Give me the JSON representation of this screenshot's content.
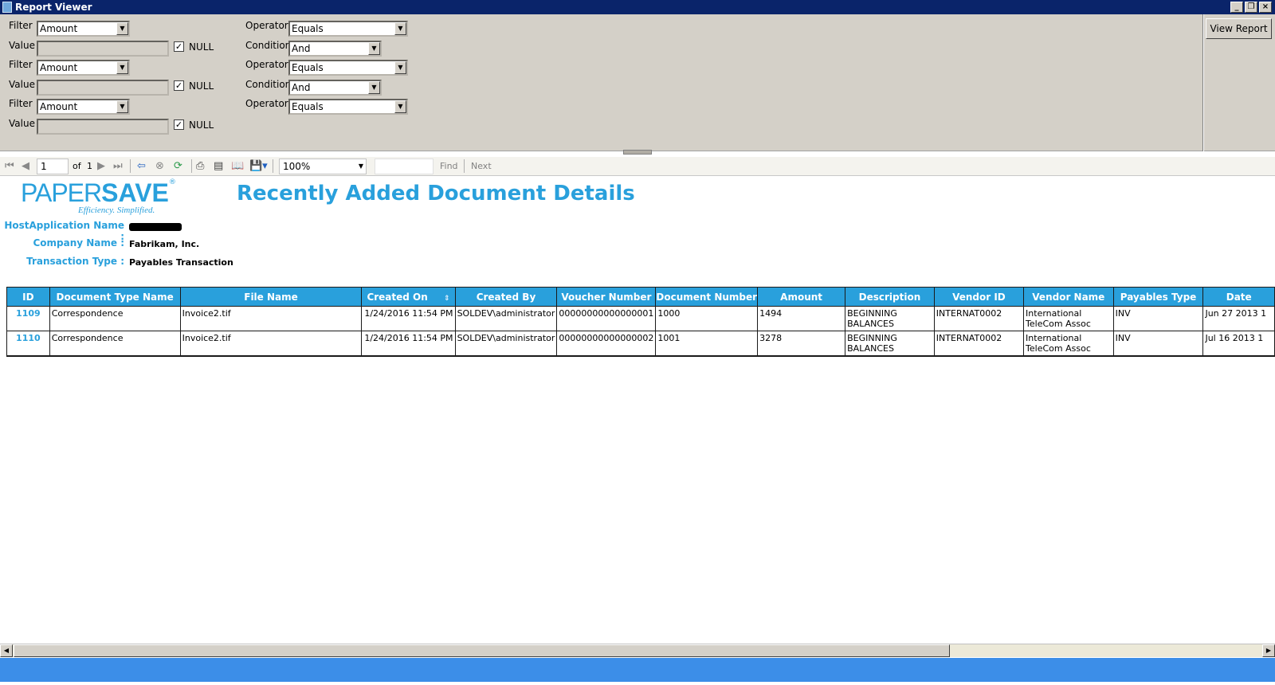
{
  "window": {
    "title": "Report Viewer"
  },
  "params": {
    "rows": [
      {
        "filter_label": "Filter",
        "filter_value": "Amount",
        "operator_label": "Operator",
        "operator_value": "Equals",
        "value_label": "Value",
        "null_label": "NULL",
        "null_checked": "✓",
        "condition_label": "Condition",
        "condition_value": "And"
      },
      {
        "filter_label": "Filter",
        "filter_value": "Amount",
        "operator_label": "Operator",
        "operator_value": "Equals",
        "value_label": "Value",
        "null_label": "NULL",
        "null_checked": "✓",
        "condition_label": "Condition",
        "condition_value": "And"
      },
      {
        "filter_label": "Filter",
        "filter_value": "Amount",
        "operator_label": "Operator",
        "operator_value": "Equals",
        "value_label": "Value",
        "null_label": "NULL",
        "null_checked": "✓"
      }
    ],
    "view_report_label": "View Report"
  },
  "toolbar": {
    "page_value": "1",
    "of_label": "of",
    "total_pages": "1",
    "zoom_value": "100%",
    "find_value": "",
    "find_label": "Find",
    "next_label": "Next"
  },
  "report": {
    "logo_paper": "PAPER",
    "logo_save": "SAVE",
    "logo_tm": "®",
    "logo_tagline": "Efficiency. Simplified.",
    "title": "Recently Added Document Details",
    "host_label": "HostApplication Name :",
    "company_label": "Company Name :",
    "company_value": "Fabrikam, Inc.",
    "transaction_label": "Transaction Type :",
    "transaction_value": "Payables Transaction",
    "columns": [
      "ID",
      "Document Type Name",
      "File Name",
      "Created On",
      "Created By",
      "Voucher Number",
      "Document Number",
      "Amount",
      "Description",
      "Vendor ID",
      "Vendor Name",
      "Payables Type",
      "Date"
    ],
    "rows": [
      {
        "id": "1109",
        "doc_type": "Correspondence",
        "file": "Invoice2.tif",
        "created_on": "1/24/2016 11:54 PM",
        "created_by": "SOLDEV\\administrator",
        "voucher": "00000000000000001",
        "doc_number": "1000",
        "amount": "1494",
        "desc1": "BEGINNING",
        "desc2": "BALANCES",
        "vendor_id": "INTERNAT0002",
        "vendor_name1": "International",
        "vendor_name2": "TeleCom Assoc",
        "payables_type": "INV",
        "date": "Jun 27 2013 1"
      },
      {
        "id": "1110",
        "doc_type": "Correspondence",
        "file": "Invoice2.tif",
        "created_on": "1/24/2016 11:54 PM",
        "created_by": "SOLDEV\\administrator",
        "voucher": "00000000000000002",
        "doc_number": "1001",
        "amount": "3278",
        "desc1": "BEGINNING",
        "desc2": "BALANCES",
        "vendor_id": "INTERNAT0002",
        "vendor_name1": "International",
        "vendor_name2": "TeleCom Assoc",
        "payables_type": "INV",
        "date": "Jul 16 2013 1"
      }
    ]
  }
}
